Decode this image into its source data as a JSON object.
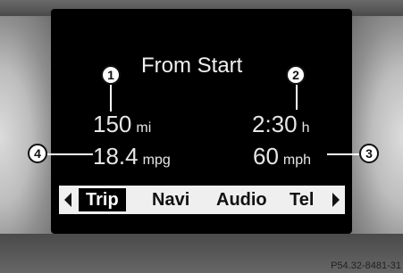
{
  "display": {
    "heading": "From Start",
    "distance": {
      "value": "150",
      "unit": "mi"
    },
    "time": {
      "value": "2:30",
      "unit": "h"
    },
    "consumption": {
      "value": "18.4",
      "unit": "mpg"
    },
    "speed": {
      "value": "60",
      "unit": "mph"
    }
  },
  "callouts": [
    "1",
    "2",
    "3",
    "4"
  ],
  "menu": {
    "items": [
      "Trip",
      "Navi",
      "Audio",
      "Tel"
    ],
    "selected": "Trip",
    "left_arrow_icon": "triangle-left-icon",
    "right_arrow_icon": "triangle-right-icon"
  },
  "figure_ref": "P54.32-8481-31"
}
